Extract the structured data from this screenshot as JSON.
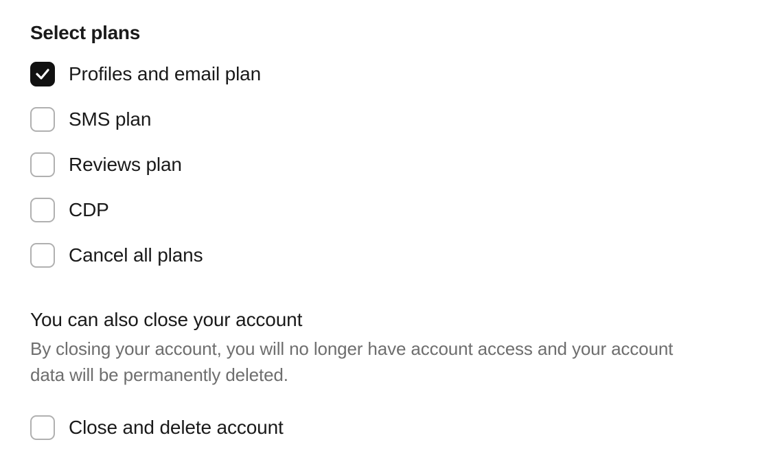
{
  "plans_section": {
    "heading": "Select plans",
    "items": [
      {
        "label": "Profiles and email plan",
        "checked": true
      },
      {
        "label": "SMS plan",
        "checked": false
      },
      {
        "label": "Reviews plan",
        "checked": false
      },
      {
        "label": "CDP",
        "checked": false
      },
      {
        "label": "Cancel all plans",
        "checked": false
      }
    ]
  },
  "close_section": {
    "heading": "You can also close your account",
    "description": "By closing your account, you will no longer have account access and your account data will be permanently deleted.",
    "option": {
      "label": "Close and delete account",
      "checked": false
    }
  }
}
